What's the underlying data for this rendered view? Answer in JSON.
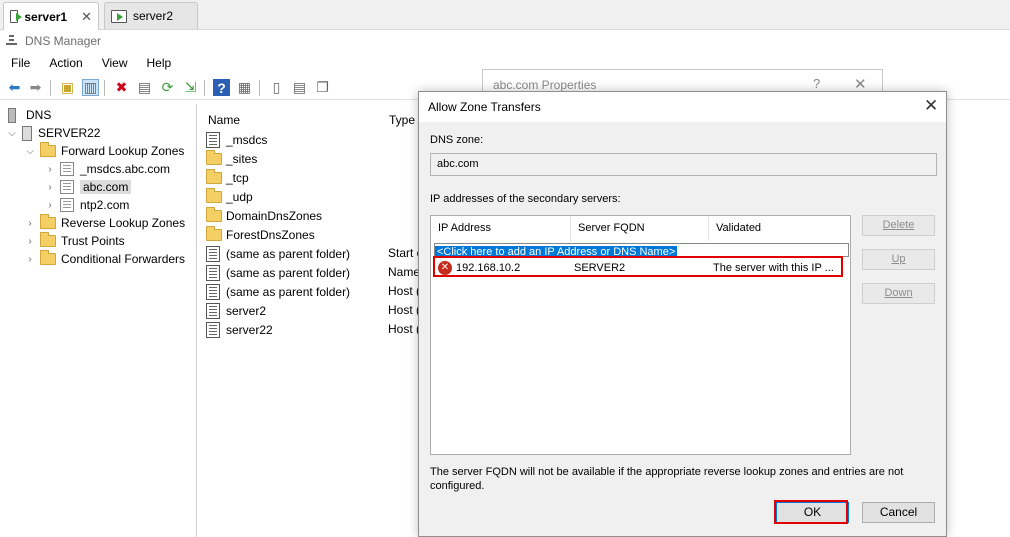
{
  "host_tabs": [
    {
      "label": "server1",
      "active": true
    },
    {
      "label": "server2",
      "active": false
    }
  ],
  "app": {
    "title": "DNS Manager"
  },
  "menu": [
    "File",
    "Action",
    "View",
    "Help"
  ],
  "tree": {
    "root": "DNS",
    "server": "SERVER22",
    "forward": "Forward Lookup Zones",
    "zones": [
      "_msdcs.abc.com",
      "abc.com",
      "ntp2.com"
    ],
    "reverse": "Reverse Lookup Zones",
    "trust": "Trust Points",
    "conditional": "Conditional Forwarders"
  },
  "details": {
    "col_name": "Name",
    "col_type": "Type",
    "rows": [
      {
        "name": "_msdcs",
        "type": ""
      },
      {
        "name": "_sites",
        "type": ""
      },
      {
        "name": "_tcp",
        "type": ""
      },
      {
        "name": "_udp",
        "type": ""
      },
      {
        "name": "DomainDnsZones",
        "type": ""
      },
      {
        "name": "ForestDnsZones",
        "type": ""
      },
      {
        "name": "(same as parent folder)",
        "type": "Start o"
      },
      {
        "name": "(same as parent folder)",
        "type": "Name"
      },
      {
        "name": "(same as parent folder)",
        "type": "Host ("
      },
      {
        "name": "server2",
        "type": "Host ("
      },
      {
        "name": "server22",
        "type": "Host ("
      }
    ]
  },
  "properties_dialog": {
    "title": "abc.com Properties",
    "help": "?",
    "close": "✕"
  },
  "dialog": {
    "title": "Allow Zone Transfers",
    "close": "✕",
    "dns_zone_label": "DNS zone:",
    "dns_zone_value": "abc.com",
    "ip_label": "IP addresses of the secondary servers:",
    "columns": [
      "IP Address",
      "Server FQDN",
      "Validated"
    ],
    "add_placeholder": "<Click here to add an IP Address or DNS Name>",
    "entry": {
      "ip": "192.168.10.2",
      "fqdn": "SERVER2",
      "validated": "The server with this IP ..."
    },
    "side_buttons": {
      "delete": "Delete",
      "up": "Up",
      "down": "Down"
    },
    "note": "The server FQDN will not be available if the appropriate reverse lookup zones and entries are not configured.",
    "ok": "OK",
    "cancel": "Cancel"
  },
  "colors": {
    "accent": "#0078d7",
    "highlight": "#e00000",
    "error": "#c42b1c"
  }
}
